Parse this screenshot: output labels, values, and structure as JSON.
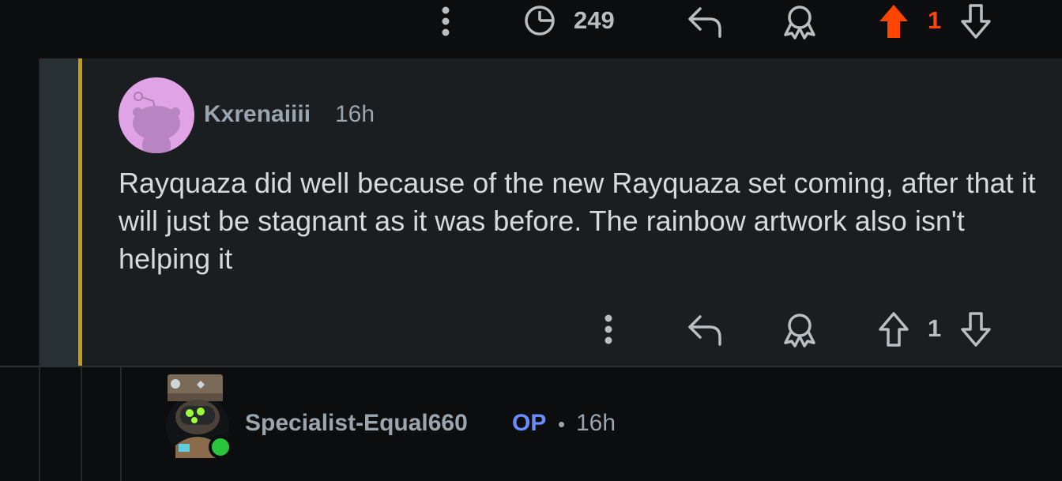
{
  "top_bar": {
    "views_count": "249",
    "vote_count": "1",
    "icons": [
      "more-vertical-icon",
      "clock-icon",
      "reply-icon",
      "award-icon",
      "upvote-filled-icon",
      "downvote-icon"
    ],
    "upvote_color": "#ff4500"
  },
  "comment": {
    "username": "Kxrenaiiii",
    "time": "16h",
    "body": "Rayquaza did well because of the new Rayquaza set coming, after that it will just be stagnant as it was before. The rainbow artwork also isn't helping it",
    "vote_count": "1",
    "accent_color": "#c79a1e",
    "avatar_color": "#e0a4e6"
  },
  "reply": {
    "username": "Specialist-Equal660",
    "op_badge": "OP",
    "separator": "•",
    "time": "16h",
    "op_color": "#6b8cff",
    "online_color": "#28c43c"
  }
}
